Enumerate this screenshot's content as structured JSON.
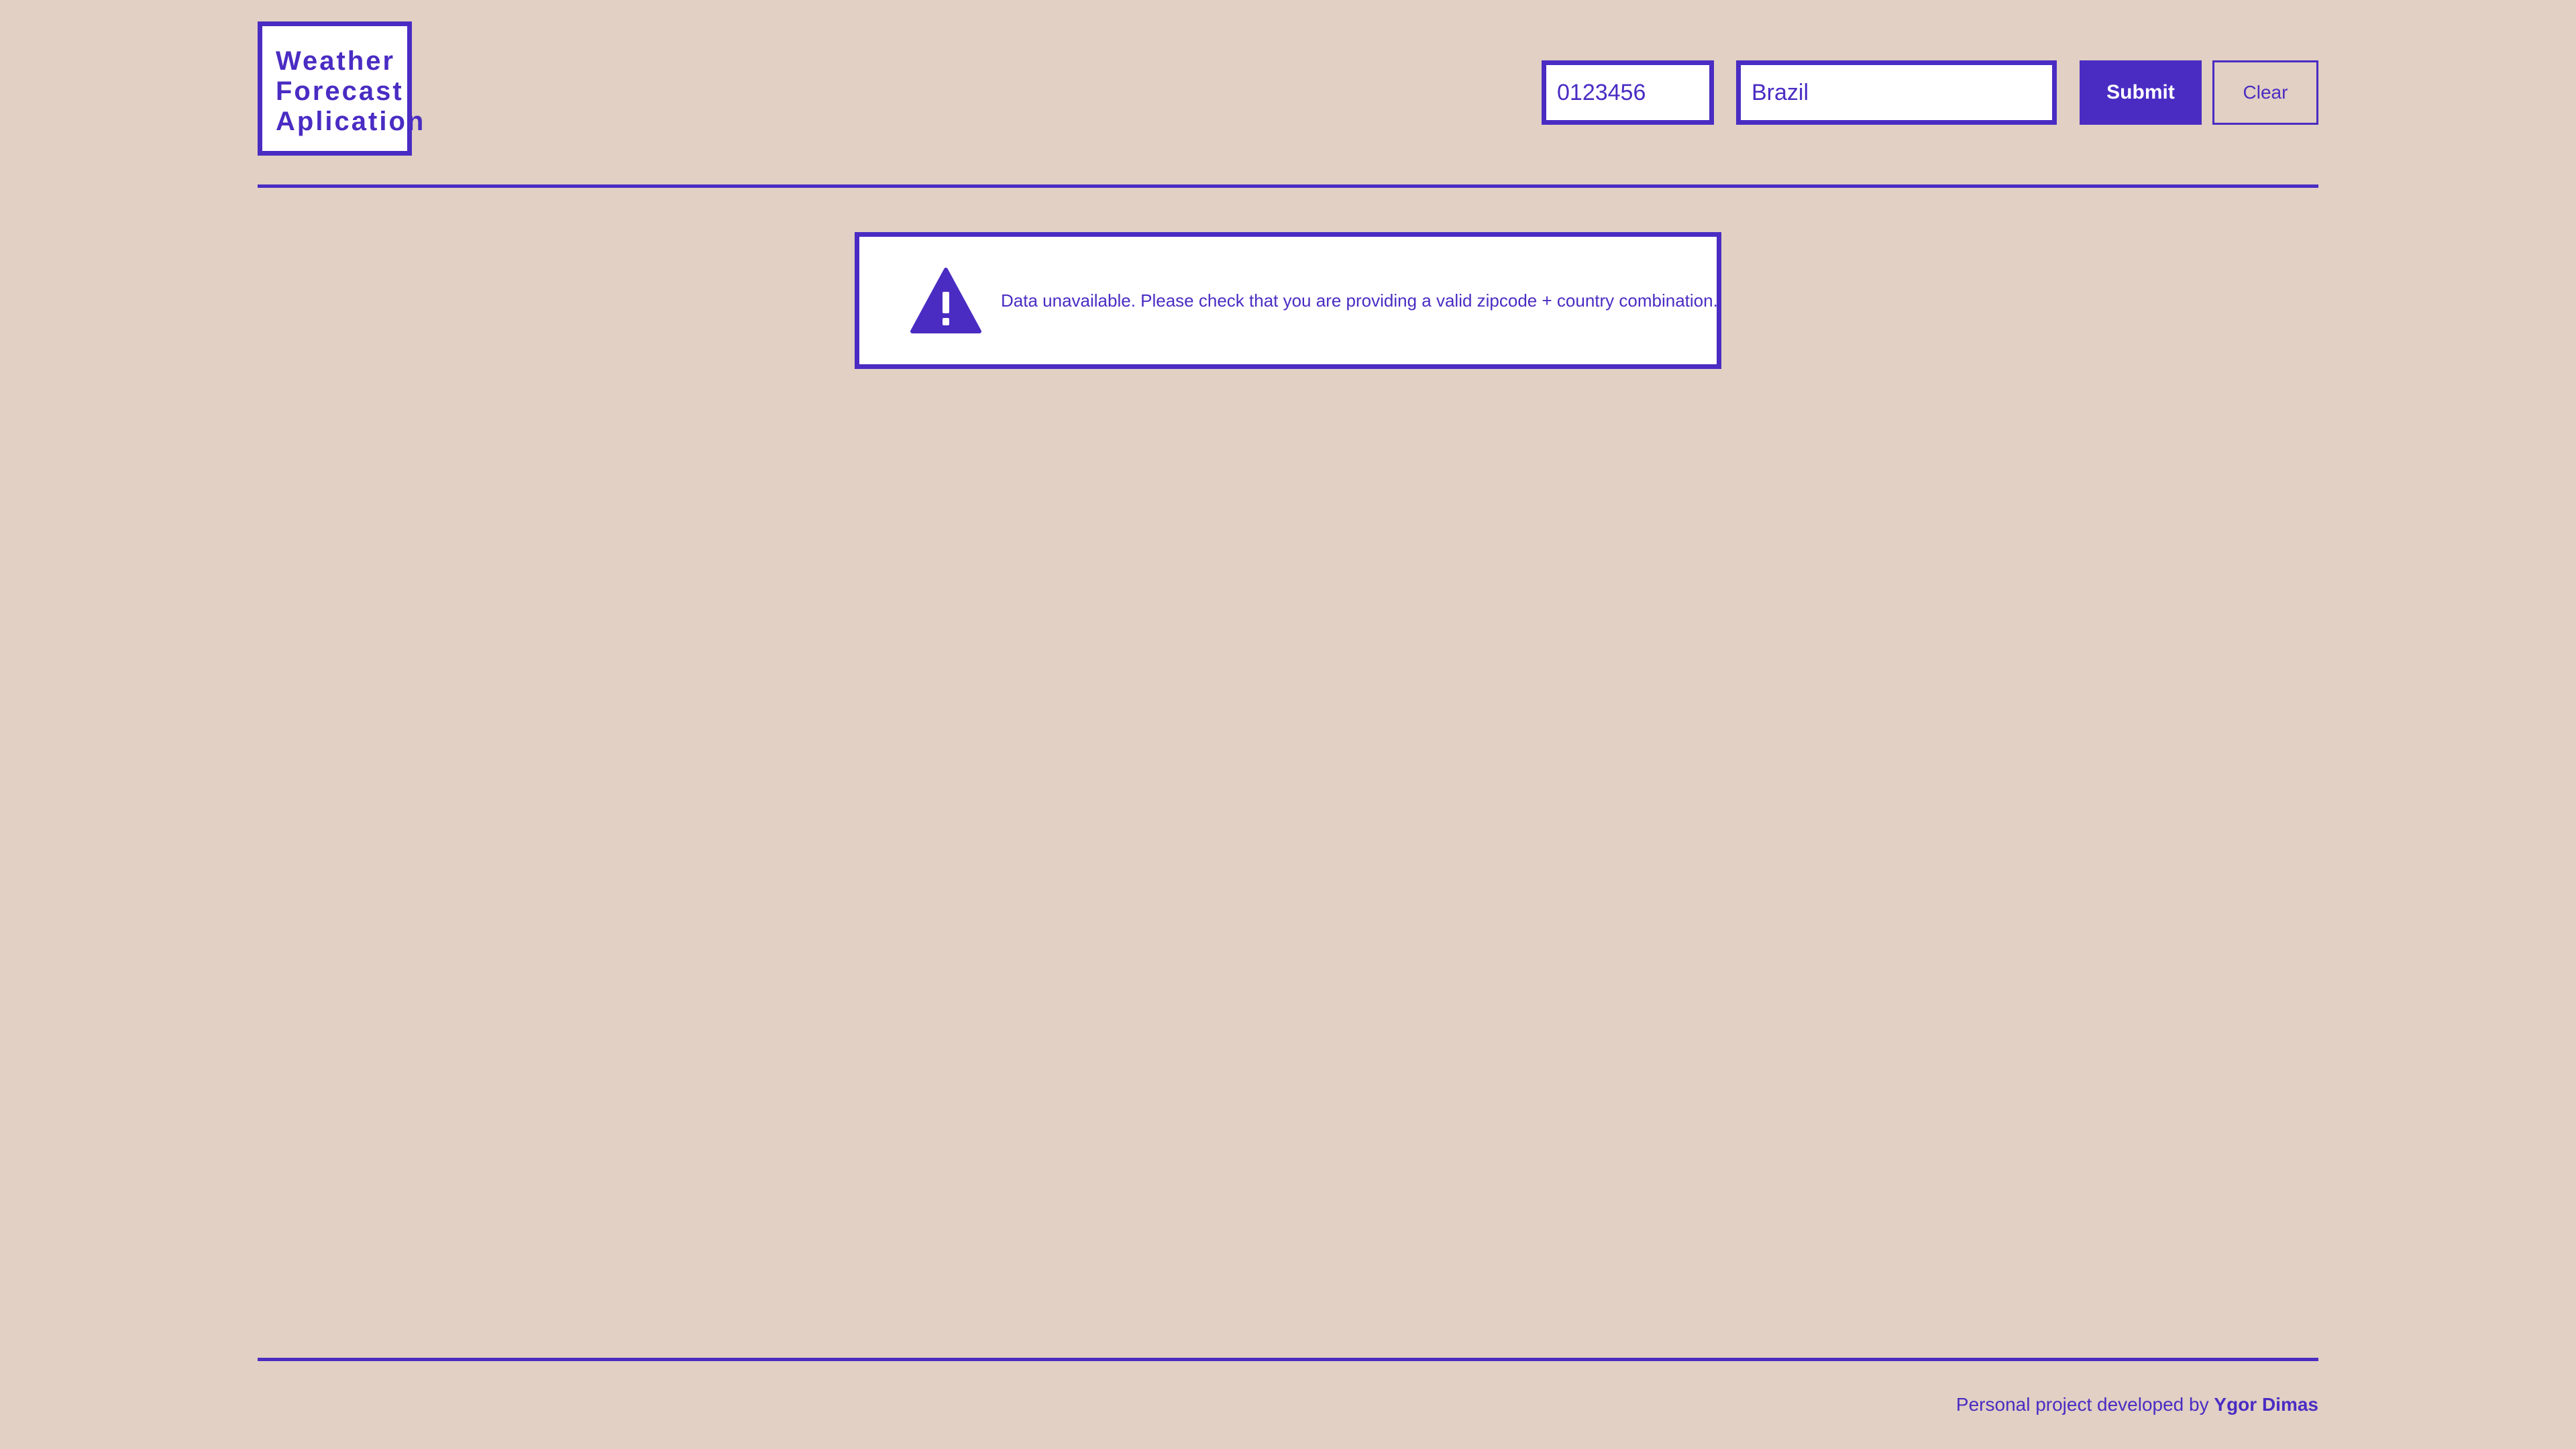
{
  "header": {
    "logo": {
      "lines": [
        "Weather",
        "Forecast",
        "Aplication"
      ]
    },
    "search": {
      "zipcode": {
        "value": "0123456",
        "placeholder": ""
      },
      "country": {
        "value": "Brazil",
        "placeholder": ""
      },
      "submit_label": "Submit",
      "clear_label": "Clear"
    }
  },
  "alert": {
    "icon": "warning-icon",
    "message": "Data unavailable. Please check that you are providing a valid zipcode + country combination."
  },
  "footer": {
    "prefix": "Personal project developed by",
    "author": "Ygor Dimas"
  },
  "theme": {
    "background": "#e1d0c3",
    "accent": "#4a2cc3",
    "surface": "#ffffff"
  }
}
